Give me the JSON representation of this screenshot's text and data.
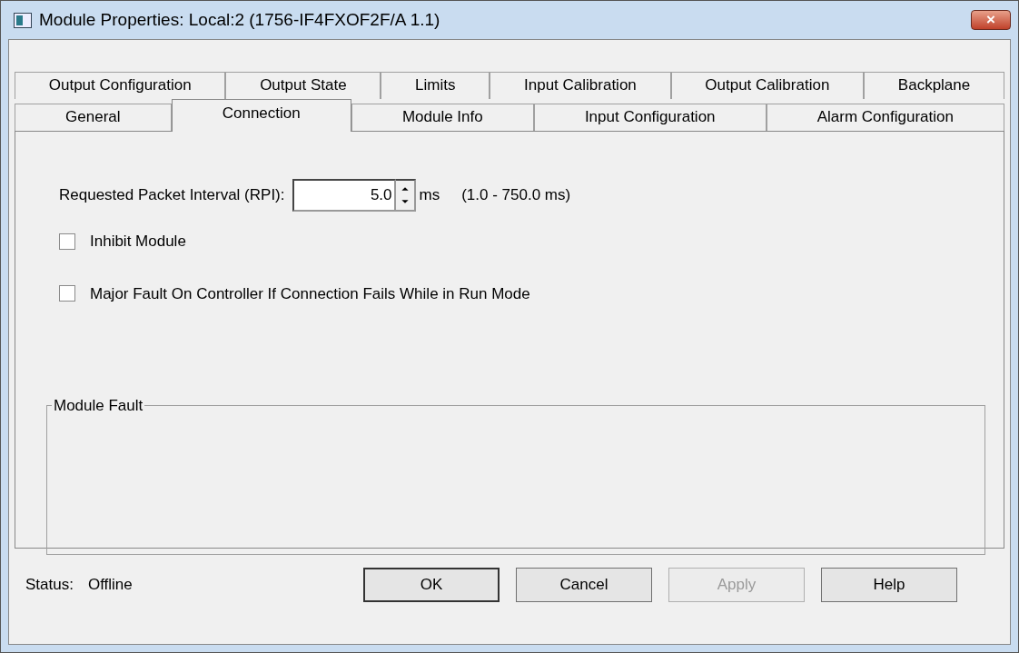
{
  "window": {
    "title": "Module Properties: Local:2 (1756-IF4FXOF2F/A 1.1)",
    "close_button": "×"
  },
  "tab_rows": [
    {
      "tabs": [
        {
          "label": "Output Configuration",
          "selected": false
        },
        {
          "label": "Output State",
          "selected": false
        },
        {
          "label": "Limits",
          "selected": false
        },
        {
          "label": "Input Calibration",
          "selected": false
        },
        {
          "label": "Output Calibration",
          "selected": false
        },
        {
          "label": "Backplane",
          "selected": false
        }
      ]
    },
    {
      "tabs": [
        {
          "label": "General",
          "selected": false
        },
        {
          "label": "Connection",
          "selected": true
        },
        {
          "label": "Module Info",
          "selected": false
        },
        {
          "label": "Input Configuration",
          "selected": false
        },
        {
          "label": "Alarm Configuration",
          "selected": false
        }
      ]
    }
  ],
  "rpi": {
    "label": "Requested Packet Interval (RPI):",
    "value": "5.0",
    "unit": "ms",
    "range": "(1.0 - 750.0 ms)"
  },
  "checkboxes": [
    {
      "label": "Inhibit Module",
      "checked": false
    },
    {
      "label": "Major Fault On Controller If Connection Fails While in Run Mode",
      "checked": false
    }
  ],
  "module_fault": {
    "title": "Module Fault"
  },
  "status": {
    "label": "Status:",
    "value": "Offline"
  },
  "buttons": [
    {
      "label": "OK",
      "disabled": false,
      "default": true
    },
    {
      "label": "Cancel",
      "disabled": false,
      "default": false
    },
    {
      "label": "Apply",
      "disabled": true,
      "default": false
    },
    {
      "label": "Help",
      "disabled": false,
      "default": false
    }
  ]
}
